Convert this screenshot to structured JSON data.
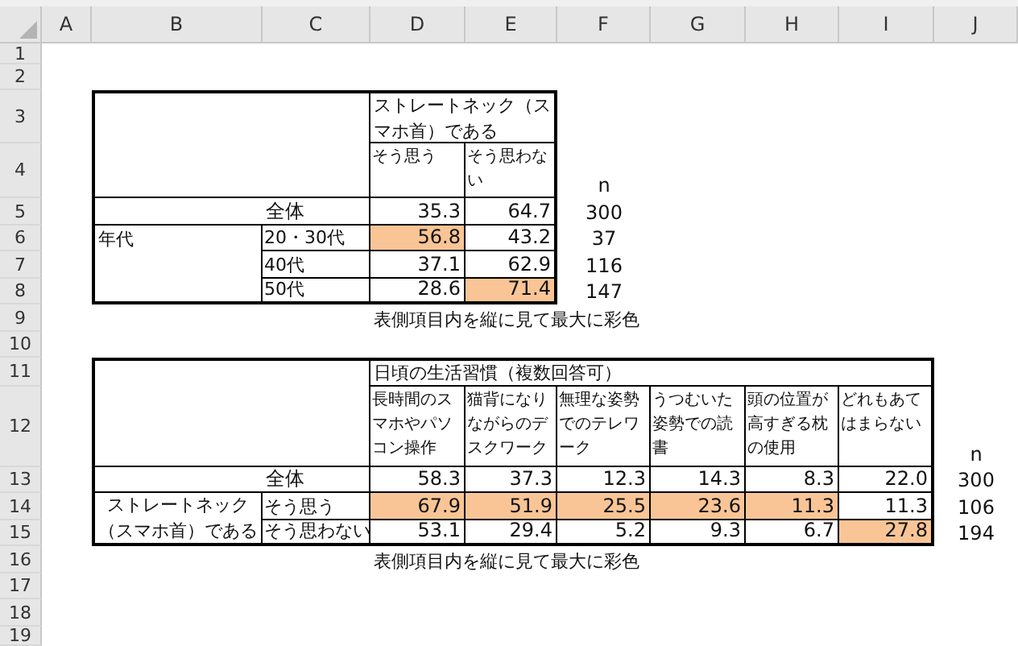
{
  "column_headers": [
    "A",
    "B",
    "C",
    "D",
    "E",
    "F",
    "G",
    "H",
    "I",
    "J"
  ],
  "row_headers": [
    "1",
    "2",
    "3",
    "4",
    "5",
    "6",
    "7",
    "8",
    "9",
    "10",
    "11",
    "12",
    "13",
    "14",
    "15",
    "16",
    "17",
    "18",
    "19"
  ],
  "tables": [
    {
      "title": "ストレートネック（スマホ首）である",
      "columns": [
        "そう思う",
        "そう思わない"
      ],
      "n_label": "n",
      "total": {
        "label": "全体",
        "values": [
          {
            "text": "35.3",
            "highlighted": false
          },
          {
            "text": "64.7",
            "highlighted": false
          }
        ],
        "n": "300"
      },
      "group": {
        "label": "年代",
        "rows": [
          {
            "label": "20・30代",
            "values": [
              {
                "text": "56.8",
                "highlighted": true
              },
              {
                "text": "43.2",
                "highlighted": false
              }
            ],
            "n": "37"
          },
          {
            "label": "40代",
            "values": [
              {
                "text": "37.1",
                "highlighted": false
              },
              {
                "text": "62.9",
                "highlighted": false
              }
            ],
            "n": "116"
          },
          {
            "label": "50代",
            "values": [
              {
                "text": "28.6",
                "highlighted": false
              },
              {
                "text": "71.4",
                "highlighted": true
              }
            ],
            "n": "147"
          }
        ]
      },
      "note": "表側項目内を縦に見て最大に彩色"
    },
    {
      "title": "日頃の生活習慣（複数回答可）",
      "columns": [
        "長時間のスマホやパソコン操作",
        "猫背になりながらのデスクワーク",
        "無理な姿勢でのテレワーク",
        "うつむいた姿勢での読書",
        "頭の位置が高すぎる枕の使用",
        "どれもあてはまらない"
      ],
      "n_label": "n",
      "total": {
        "label": "全体",
        "values": [
          {
            "text": "58.3",
            "highlighted": false
          },
          {
            "text": "37.3",
            "highlighted": false
          },
          {
            "text": "12.3",
            "highlighted": false
          },
          {
            "text": "14.3",
            "highlighted": false
          },
          {
            "text": "8.3",
            "highlighted": false
          },
          {
            "text": "22.0",
            "highlighted": false
          }
        ],
        "n": "300"
      },
      "group": {
        "label": "ストレートネック（スマホ首）である",
        "rows": [
          {
            "label": "そう思う",
            "values": [
              {
                "text": "67.9",
                "highlighted": true
              },
              {
                "text": "51.9",
                "highlighted": true
              },
              {
                "text": "25.5",
                "highlighted": true
              },
              {
                "text": "23.6",
                "highlighted": true
              },
              {
                "text": "11.3",
                "highlighted": true
              },
              {
                "text": "11.3",
                "highlighted": false
              }
            ],
            "n": "106"
          },
          {
            "label": "そう思わない",
            "values": [
              {
                "text": "53.1",
                "highlighted": false
              },
              {
                "text": "29.4",
                "highlighted": false
              },
              {
                "text": "5.2",
                "highlighted": false
              },
              {
                "text": "9.3",
                "highlighted": false
              },
              {
                "text": "6.7",
                "highlighted": false
              },
              {
                "text": "27.8",
                "highlighted": true
              }
            ],
            "n": "194"
          }
        ]
      },
      "note": "表側項目内を縦に見て最大に彩色"
    }
  ]
}
